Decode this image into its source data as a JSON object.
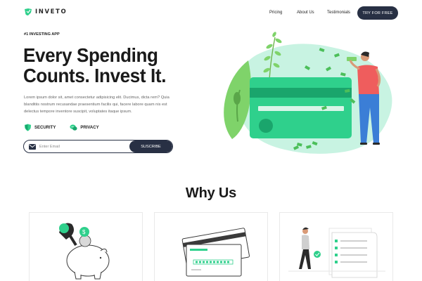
{
  "nav": {
    "brand": "INVETO",
    "links": [
      "Pricing",
      "About Us",
      "Testimonials"
    ],
    "cta": "TRY FOR FREE"
  },
  "hero": {
    "eyebrow": "#1 INVESTING APP",
    "headline_line1": "Every Spending",
    "headline_line2": "Counts. Invest It.",
    "lede": "Lorem ipsum dolor sit, amet consectetur adipisicing elit. Ducimus, dicta rem? Quia blanditiis nostrum recusandae praesentium facilis qui, facere labore quam nis est delectus tempore inventore suscipit, voluptates itaque ipsum.",
    "badges": [
      "SECURITY",
      "PRIVACY"
    ],
    "email_placeholder": "Enter Email",
    "subscribe_label": "SUSCRIBE"
  },
  "why": {
    "title": "Why Us"
  },
  "colors": {
    "accent": "#2fd08c",
    "dark": "#283044",
    "blob": "#c8f3e2"
  },
  "icons": {
    "logo": "shield-leaf-icon",
    "security": "shield-icon",
    "privacy": "chat-icon",
    "mail": "mail-icon"
  }
}
